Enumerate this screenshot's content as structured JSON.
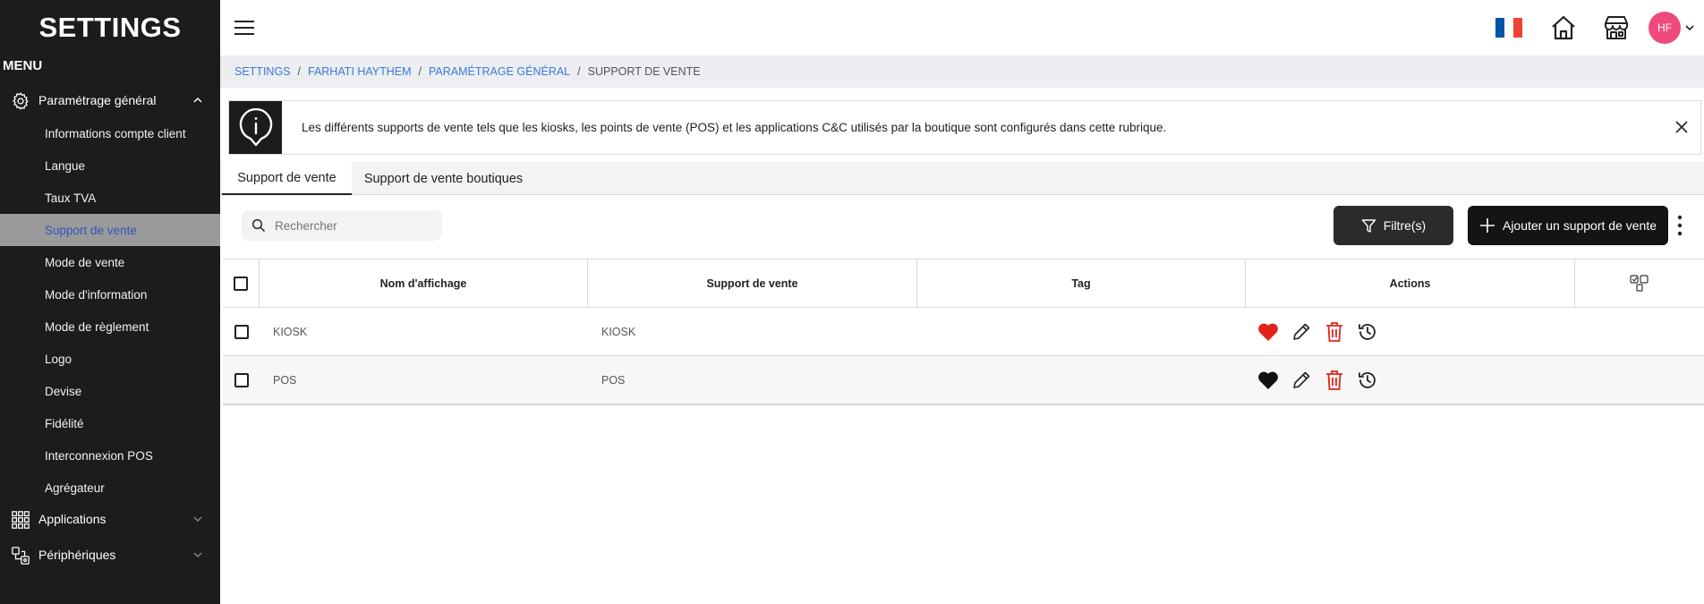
{
  "sidebar": {
    "brand": "SETTINGS",
    "menu_label": "MENU",
    "group_general": "Paramétrage général",
    "items": [
      {
        "label": "Informations compte client"
      },
      {
        "label": "Langue"
      },
      {
        "label": "Taux TVA"
      },
      {
        "label": "Support de vente"
      },
      {
        "label": "Mode de vente"
      },
      {
        "label": "Mode d'information"
      },
      {
        "label": "Mode de règlement"
      },
      {
        "label": "Logo"
      },
      {
        "label": "Devise"
      },
      {
        "label": "Fidélité"
      },
      {
        "label": "Interconnexion POS"
      },
      {
        "label": "Agrégateur"
      }
    ],
    "active_item": "Support de vente",
    "group_applications": "Applications",
    "group_peripheriques": "Périphériques"
  },
  "topbar": {
    "avatar_initials": "HF",
    "flag_colors": [
      "#0055A4",
      "#FFFFFF",
      "#EF4135"
    ],
    "icons": [
      "menu-icon",
      "home-icon",
      "store-icon"
    ]
  },
  "breadcrumb": {
    "items": [
      "SETTINGS",
      "FARHATI HAYTHEM",
      "PARAMÉTRAGE GÉNÉRAL",
      "SUPPORT DE VENTE"
    ],
    "separator": "/"
  },
  "info_banner": {
    "text": "Les différents supports de vente tels que les kiosks, les points de vente (POS) et les applications C&C utilisés par la boutique sont configurés dans cette rubrique."
  },
  "tabs": [
    {
      "label": "Support de vente",
      "active": true
    },
    {
      "label": "Support de vente boutiques",
      "active": false
    }
  ],
  "toolbar": {
    "search_placeholder": "Rechercher",
    "filter_label": "Filtre(s)",
    "add_label": "Ajouter un support de vente"
  },
  "table": {
    "columns": [
      "Nom d'affichage",
      "Support de vente",
      "Tag",
      "Actions"
    ],
    "rows": [
      {
        "name": "KIOSK",
        "support": "KIOSK",
        "tag": "",
        "favorite": true
      },
      {
        "name": "POS",
        "support": "POS",
        "tag": "",
        "favorite": false
      }
    ]
  },
  "colors": {
    "sidebar_bg": "#1c1c1c",
    "active_item_bg": "#9a9a9a",
    "active_item_text": "#2f55b9",
    "link": "#3a7bd5",
    "danger": "#e2231a",
    "avatar_bg": "#ef4a7d"
  }
}
